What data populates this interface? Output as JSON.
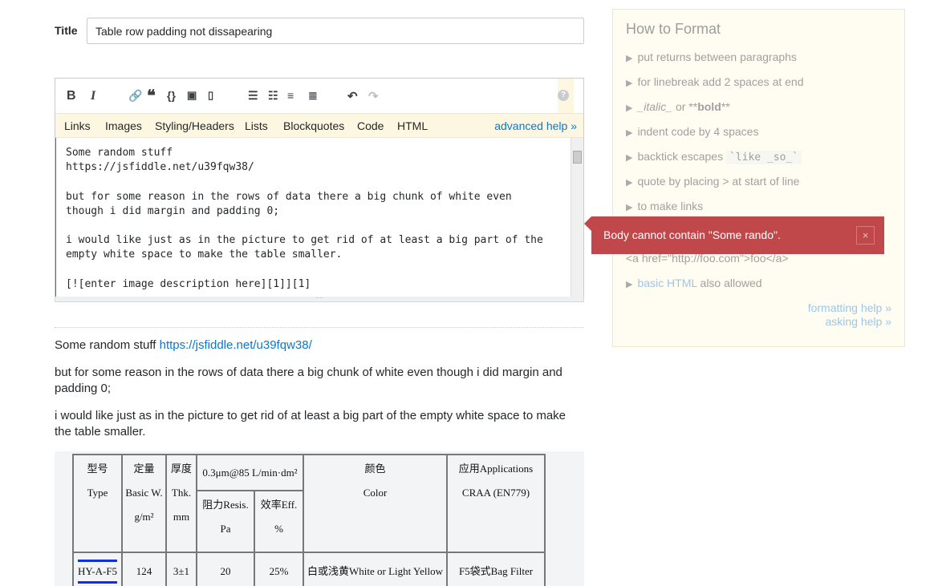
{
  "title_label": "Title",
  "title_value": "Table row padding not dissapearing",
  "toolbar": {
    "icons": [
      "bold-icon",
      "italic-icon",
      "link-icon",
      "blockquote-icon",
      "code-icon",
      "image-icon",
      "snippet-icon",
      "numbered-list-icon",
      "bulleted-list-icon",
      "heading-icon",
      "horizontal-rule-icon",
      "undo-icon",
      "redo-icon",
      "help-icon"
    ]
  },
  "helpbar": {
    "items": [
      "Links",
      "Images",
      "Styling/Headers",
      "Lists",
      "Blockquotes",
      "Code",
      "HTML"
    ],
    "advanced": "advanced help »"
  },
  "body_text": "Some random stuff\nhttps://jsfiddle.net/u39fqw38/\n\nbut for some reason in the rows of data there a big chunk of white even\nthough i did margin and padding 0;\n\ni would like just as in the picture to get rid of at least a big part of the\nempty white space to make the table smaller.\n\n[![enter image description here][1]][1]",
  "preview": {
    "p1_text": "Some random stuff ",
    "p1_link": "https://jsfiddle.net/u39fqw38/",
    "p2": "but for some reason in the rows of data there a big chunk of white even though i did margin and padding 0;",
    "p3": "i would like just as in the picture to get rid of at least a big part of the empty white space to make the table smaller."
  },
  "table": {
    "h_type_cn": "型号",
    "h_type": "Type",
    "h_basic_cn": "定量",
    "h_basic": "Basic W.",
    "h_basic_unit": "g/m²",
    "h_thk_cn": "厚度",
    "h_thk": "Thk.",
    "h_thk_unit": "mm",
    "h_test": "0.3μm@85 L/min·dm²",
    "h_resis": "阻力Resis.",
    "h_resis_unit": "Pa",
    "h_eff": "效率Eff.",
    "h_eff_unit": "%",
    "h_color_cn": "颜色",
    "h_color": "Color",
    "h_app": "应用Applications",
    "h_app2": "CRAA (EN779)",
    "row": [
      "HY-A-F5",
      "124",
      "3±1",
      "20",
      "25%",
      "白或浅黄White or Light Yellow",
      "F5袋式Bag Filter"
    ]
  },
  "sidebar": {
    "title": "How to Format",
    "items": [
      "put returns between paragraphs",
      "for linebreak add 2 spaces at end",
      "indent code by 4 spaces",
      "backtick escapes ",
      "quote by placing > at start of line",
      "to make links"
    ],
    "italic": "_italic_",
    "or": " or ",
    "bold_pre": "**",
    "bold": "bold",
    "bold_post": "**",
    "code_example": "`like _so_`",
    "link_example": "<a href=\"http://foo.com\">foo</a>",
    "basic_html": "basic HTML",
    "also_allowed": " also allowed",
    "formatting_help": "formatting help »",
    "asking_help": "asking help »"
  },
  "error": {
    "message": "Body cannot contain \"Some rando\".",
    "close": "×",
    "color": "#c0474a"
  }
}
